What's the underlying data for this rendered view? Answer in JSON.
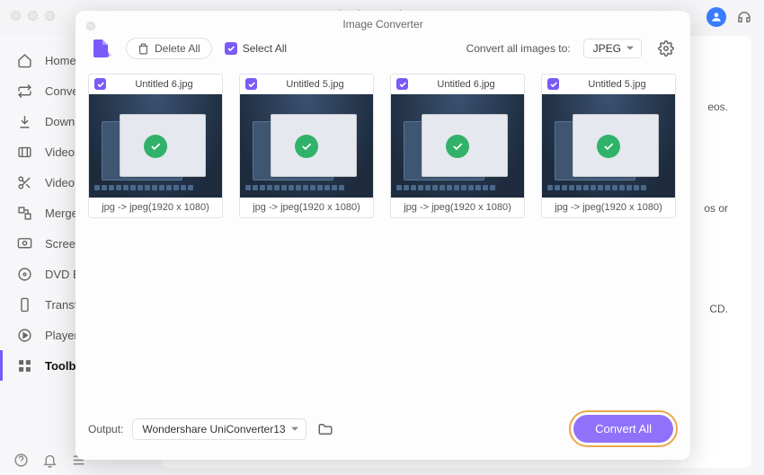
{
  "app_title": "Wondershare UniConverter",
  "sidebar": {
    "items": [
      {
        "label": "Home"
      },
      {
        "label": "Converter"
      },
      {
        "label": "Downloader"
      },
      {
        "label": "Video Compressor"
      },
      {
        "label": "Video Editor"
      },
      {
        "label": "Merger"
      },
      {
        "label": "Screen Recorder"
      },
      {
        "label": "DVD Burner"
      },
      {
        "label": "Transfer"
      },
      {
        "label": "Player"
      },
      {
        "label": "Toolbox"
      }
    ]
  },
  "background_hints": {
    "t1": "eos.",
    "t2": "os or",
    "t3": "CD."
  },
  "modal": {
    "title": "Image Converter",
    "delete_all_label": "Delete All",
    "select_all_label": "Select All",
    "convert_to_label": "Convert all images to:",
    "format_selected": "JPEG",
    "output_label": "Output:",
    "output_path": "Wondershare UniConverter13",
    "convert_all_label": "Convert All"
  },
  "cards": [
    {
      "filename": "Untitled 6.jpg",
      "meta": "jpg -> jpeg(1920 x 1080)"
    },
    {
      "filename": "Untitled 5.jpg",
      "meta": "jpg -> jpeg(1920 x 1080)"
    },
    {
      "filename": "Untitled 6.jpg",
      "meta": "jpg -> jpeg(1920 x 1080)"
    },
    {
      "filename": "Untitled 5.jpg",
      "meta": "jpg -> jpeg(1920 x 1080)"
    }
  ]
}
